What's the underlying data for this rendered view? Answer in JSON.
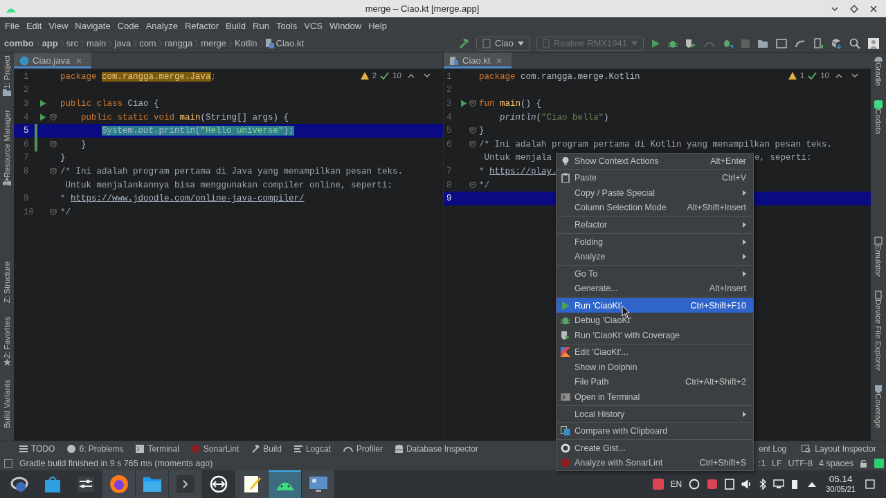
{
  "window": {
    "title": "merge – Ciao.kt [merge.app]"
  },
  "menu_bar": [
    "File",
    "Edit",
    "View",
    "Navigate",
    "Code",
    "Analyze",
    "Refactor",
    "Build",
    "Run",
    "Tools",
    "VCS",
    "Window",
    "Help"
  ],
  "breadcrumb": [
    "combo",
    "app",
    "src",
    "main",
    "java",
    "com",
    "rangga",
    "merge",
    "Kotlin",
    "Ciao.kt"
  ],
  "toolbar": {
    "run_config": "Ciao",
    "device": {
      "label": "Realme RMX1941",
      "disabled": true
    }
  },
  "left_strip": [
    "1: Project",
    "Resource Manager",
    "Z: Structure",
    "2: Favorites",
    "Build Variants"
  ],
  "right_strip": [
    "Gradle",
    "Codota",
    "Emulator",
    "Device File Explorer",
    "Coverage"
  ],
  "editors": [
    {
      "tab": {
        "label": "Ciao.java",
        "selected": true
      },
      "warnings": "2",
      "checks": "10",
      "lines": [
        {
          "number": "1",
          "current": false,
          "changed": false,
          "run": false,
          "tokens": [
            {
              "text": "package ",
              "kind": "keyword"
            },
            {
              "text": "com.rangga.merge.Java",
              "kind": "highlight"
            },
            {
              "text": ";",
              "kind": "keyword"
            }
          ]
        },
        {
          "number": "2",
          "current": false,
          "changed": false,
          "run": false
        },
        {
          "number": "3",
          "current": false,
          "changed": false,
          "run": true,
          "tokens": [
            {
              "text": "public class ",
              "kind": "keyword"
            },
            {
              "text": "Ciao {",
              "kind": "text"
            }
          ]
        },
        {
          "number": "4",
          "current": false,
          "changed": false,
          "run": true,
          "fold": true,
          "tokens": [
            {
              "text": "    public static void ",
              "kind": "keyword"
            },
            {
              "text": "main",
              "kind": "function"
            },
            {
              "text": "(String[] args) {",
              "kind": "text"
            }
          ]
        },
        {
          "number": "5",
          "current": true,
          "changed": true,
          "run": false,
          "text_selected": true,
          "tokens": [
            {
              "text": "        System.",
              "kind": "text"
            },
            {
              "text": "out",
              "kind": "italic"
            },
            {
              "text": ".println(",
              "kind": "text"
            },
            {
              "text": "\"Hello universe\"",
              "kind": "string"
            },
            {
              "text": ");",
              "kind": "text"
            }
          ]
        },
        {
          "number": "6",
          "current": false,
          "changed": true,
          "run": false,
          "fold": true,
          "tokens": [
            {
              "text": "    }",
              "kind": "text"
            }
          ]
        },
        {
          "number": "7",
          "current": false,
          "changed": false,
          "run": false,
          "tokens": [
            {
              "text": "}",
              "kind": "text"
            }
          ]
        },
        {
          "number": "8",
          "current": false,
          "changed": false,
          "run": false,
          "fold": true,
          "tokens": [
            {
              "text": "/* Ini adalah program pertama di Java yang menampilkan pesan teks.",
              "kind": "comment"
            }
          ],
          "wrap": [
            {
              "text": " Untuk menjalankannya bisa menggunakan compiler online, seperti:",
              "kind": "comment"
            }
          ]
        },
        {
          "number": "9",
          "current": false,
          "changed": false,
          "run": false,
          "tokens": [
            {
              "text": "* ",
              "kind": "comment"
            },
            {
              "text": "https://www.jdoodle.com/online-java-compiler/",
              "kind": "link"
            }
          ]
        },
        {
          "number": "10",
          "current": false,
          "changed": false,
          "run": false,
          "fold": true,
          "tokens": [
            {
              "text": "*/",
              "kind": "comment"
            }
          ]
        }
      ]
    },
    {
      "tab": {
        "label": "Ciao.kt",
        "selected": true
      },
      "warnings": "1",
      "checks": "10",
      "lines": [
        {
          "number": "1",
          "current": false,
          "changed": false,
          "run": false,
          "tokens": [
            {
              "text": "package ",
              "kind": "keyword"
            },
            {
              "text": "com.rangga.merge.Kotlin",
              "kind": "text"
            }
          ]
        },
        {
          "number": "2",
          "current": false,
          "changed": false,
          "run": false
        },
        {
          "number": "3",
          "current": false,
          "changed": false,
          "run": true,
          "fold": true,
          "tokens": [
            {
              "text": "fun ",
              "kind": "keyword"
            },
            {
              "text": "main",
              "kind": "function"
            },
            {
              "text": "() {",
              "kind": "text"
            }
          ]
        },
        {
          "number": "4",
          "current": false,
          "changed": false,
          "run": false,
          "tokens": [
            {
              "text": "    println",
              "kind": "italic"
            },
            {
              "text": "(",
              "kind": "text"
            },
            {
              "text": "\"Ciao bella\"",
              "kind": "string"
            },
            {
              "text": ")",
              "kind": "text"
            }
          ]
        },
        {
          "number": "5",
          "current": false,
          "changed": false,
          "run": false,
          "fold": true,
          "tokens": [
            {
              "text": "}",
              "kind": "text"
            }
          ]
        },
        {
          "number": "6",
          "current": false,
          "changed": false,
          "run": false,
          "fold": true,
          "tokens": [
            {
              "text": "/* Ini adalah program pertama di Kotlin yang menampilkan pesan teks.",
              "kind": "comment"
            }
          ],
          "wrap": [
            {
              "text": " Untuk menjala",
              "kind": "comment"
            },
            {
              "text": "e, seperti:",
              "kind": "comment",
              "after_menu": true
            }
          ]
        },
        {
          "number": "7",
          "current": false,
          "changed": false,
          "run": false,
          "tokens": [
            {
              "text": "* ",
              "kind": "comment"
            },
            {
              "text": "https://play.",
              "kind": "link"
            }
          ]
        },
        {
          "number": "8",
          "current": false,
          "changed": false,
          "run": false,
          "fold": true,
          "tokens": [
            {
              "text": "*/",
              "kind": "comment"
            }
          ]
        },
        {
          "number": "9",
          "current": true,
          "changed": false,
          "run": false
        }
      ]
    }
  ],
  "context_menu": [
    [
      {
        "label": "Show Context Actions",
        "shortcut": "Alt+Enter",
        "submenu": false,
        "selected": false
      }
    ],
    [
      {
        "label": "Paste",
        "shortcut": "Ctrl+V",
        "submenu": false,
        "selected": false
      },
      {
        "label": "Copy / Paste Special",
        "submenu": true,
        "selected": false
      },
      {
        "label": "Column Selection Mode",
        "shortcut": "Alt+Shift+Insert",
        "submenu": false,
        "selected": false
      }
    ],
    [
      {
        "label": "Refactor",
        "submenu": true,
        "selected": false
      }
    ],
    [
      {
        "label": "Folding",
        "submenu": true,
        "selected": false
      },
      {
        "label": "Analyze",
        "submenu": true,
        "selected": false
      }
    ],
    [
      {
        "label": "Go To",
        "submenu": true,
        "selected": false
      },
      {
        "label": "Generate...",
        "shortcut": "Alt+Insert",
        "submenu": false,
        "selected": false
      }
    ],
    [
      {
        "label": "Run 'CiaoKt'",
        "shortcut": "Ctrl+Shift+F10",
        "submenu": false,
        "selected": true
      },
      {
        "label": "Debug 'CiaoKt'",
        "submenu": false,
        "selected": false
      },
      {
        "label": "Run 'CiaoKt' with Coverage",
        "submenu": false,
        "selected": false
      }
    ],
    [
      {
        "label": "Edit 'CiaoKt'...",
        "submenu": false,
        "selected": false
      },
      {
        "label": "Show in Dolphin",
        "submenu": false,
        "selected": false
      },
      {
        "label": "File Path",
        "shortcut": "Ctrl+Alt+Shift+2",
        "submenu": false,
        "selected": false
      },
      {
        "label": "Open in Terminal",
        "submenu": false,
        "selected": false
      }
    ],
    [
      {
        "label": "Local History",
        "submenu": true,
        "selected": false
      }
    ],
    [
      {
        "label": "Compare with Clipboard",
        "submenu": false,
        "selected": false
      }
    ],
    [
      {
        "label": "Create Gist...",
        "submenu": false,
        "selected": false
      },
      {
        "label": "Analyze with SonarLint",
        "shortcut": "Ctrl+Shift+S",
        "submenu": false,
        "selected": false
      }
    ]
  ],
  "tool_windows": {
    "left": [
      "TODO",
      "6: Problems",
      "Terminal",
      "SonarLint",
      "Build",
      "Logcat",
      "Profiler",
      "Database Inspector"
    ],
    "right": [
      "ent Log",
      "Layout Inspector"
    ]
  },
  "status_bar": {
    "message": "Gradle build finished in 9 s 765 ms (moments ago)",
    "items": [
      ":1",
      "LF",
      "UTF-8",
      "4 spaces"
    ]
  },
  "taskbar": {
    "apps": [
      {
        "open": false,
        "active": false
      },
      {
        "open": false,
        "active": false
      },
      {
        "open": false,
        "active": false
      },
      {
        "open": true,
        "active": false
      },
      {
        "open": true,
        "active": false
      },
      {
        "open": true,
        "active": false
      },
      {
        "open": false,
        "active": false
      },
      {
        "open": true,
        "active": false
      },
      {
        "open": true,
        "active": true
      },
      {
        "open": true,
        "active": false
      }
    ],
    "language": "EN",
    "time": "05.14",
    "date": "30/05/21"
  }
}
